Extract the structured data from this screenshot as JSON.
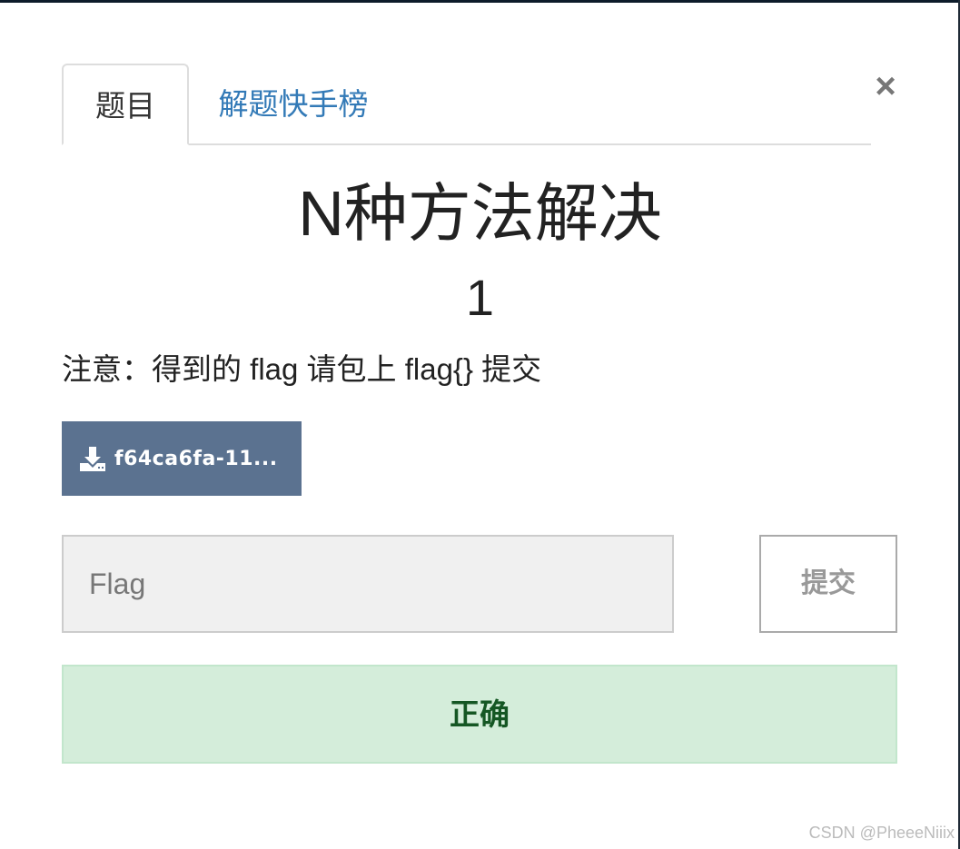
{
  "tabs": [
    {
      "label": "题目",
      "active": true
    },
    {
      "label": "解题快手榜",
      "active": false
    }
  ],
  "close": {
    "label": "×"
  },
  "challenge": {
    "title": "N种方法解决",
    "points": "1",
    "notice": "注意：得到的 flag 请包上 flag{} 提交",
    "download_label": "f64ca6fa-11..."
  },
  "flag_form": {
    "placeholder": "Flag",
    "value": "",
    "submit_label": "提交"
  },
  "result": {
    "message": "正确"
  },
  "watermark": "CSDN @PheeeNiiix",
  "colors": {
    "tab_link": "#337ab7",
    "download_button": "#5b7290",
    "alert_background": "#d4edda",
    "alert_text": "#155724"
  },
  "icons": {
    "close": "close-icon",
    "download": "download-icon"
  }
}
